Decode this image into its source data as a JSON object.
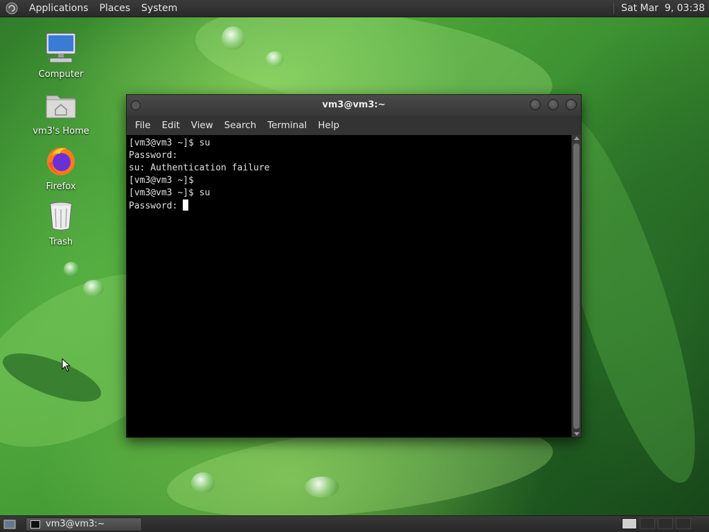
{
  "top_panel": {
    "menus": [
      "Applications",
      "Places",
      "System"
    ],
    "clock": "Sat Mar  9, 03:38"
  },
  "desktop_icons": [
    {
      "label": "Computer",
      "icon": "computer-icon"
    },
    {
      "label": "vm3's Home",
      "icon": "home-folder-icon"
    },
    {
      "label": "Firefox",
      "icon": "firefox-icon"
    },
    {
      "label": "Trash",
      "icon": "trash-icon"
    }
  ],
  "window": {
    "title": "vm3@vm3:~",
    "menus": [
      "File",
      "Edit",
      "View",
      "Search",
      "Terminal",
      "Help"
    ],
    "terminal_lines": [
      "[vm3@vm3 ~]$ su",
      "Password:",
      "su: Authentication failure",
      "[vm3@vm3 ~]$",
      "[vm3@vm3 ~]$ su",
      "Password: "
    ]
  },
  "taskbar": {
    "task_label": "vm3@vm3:~"
  },
  "colors": {
    "panel": "#2f2f2f",
    "terminal_bg": "#000000",
    "terminal_fg": "#e0e0e0",
    "wallpaper_green": "#3b8f30"
  }
}
